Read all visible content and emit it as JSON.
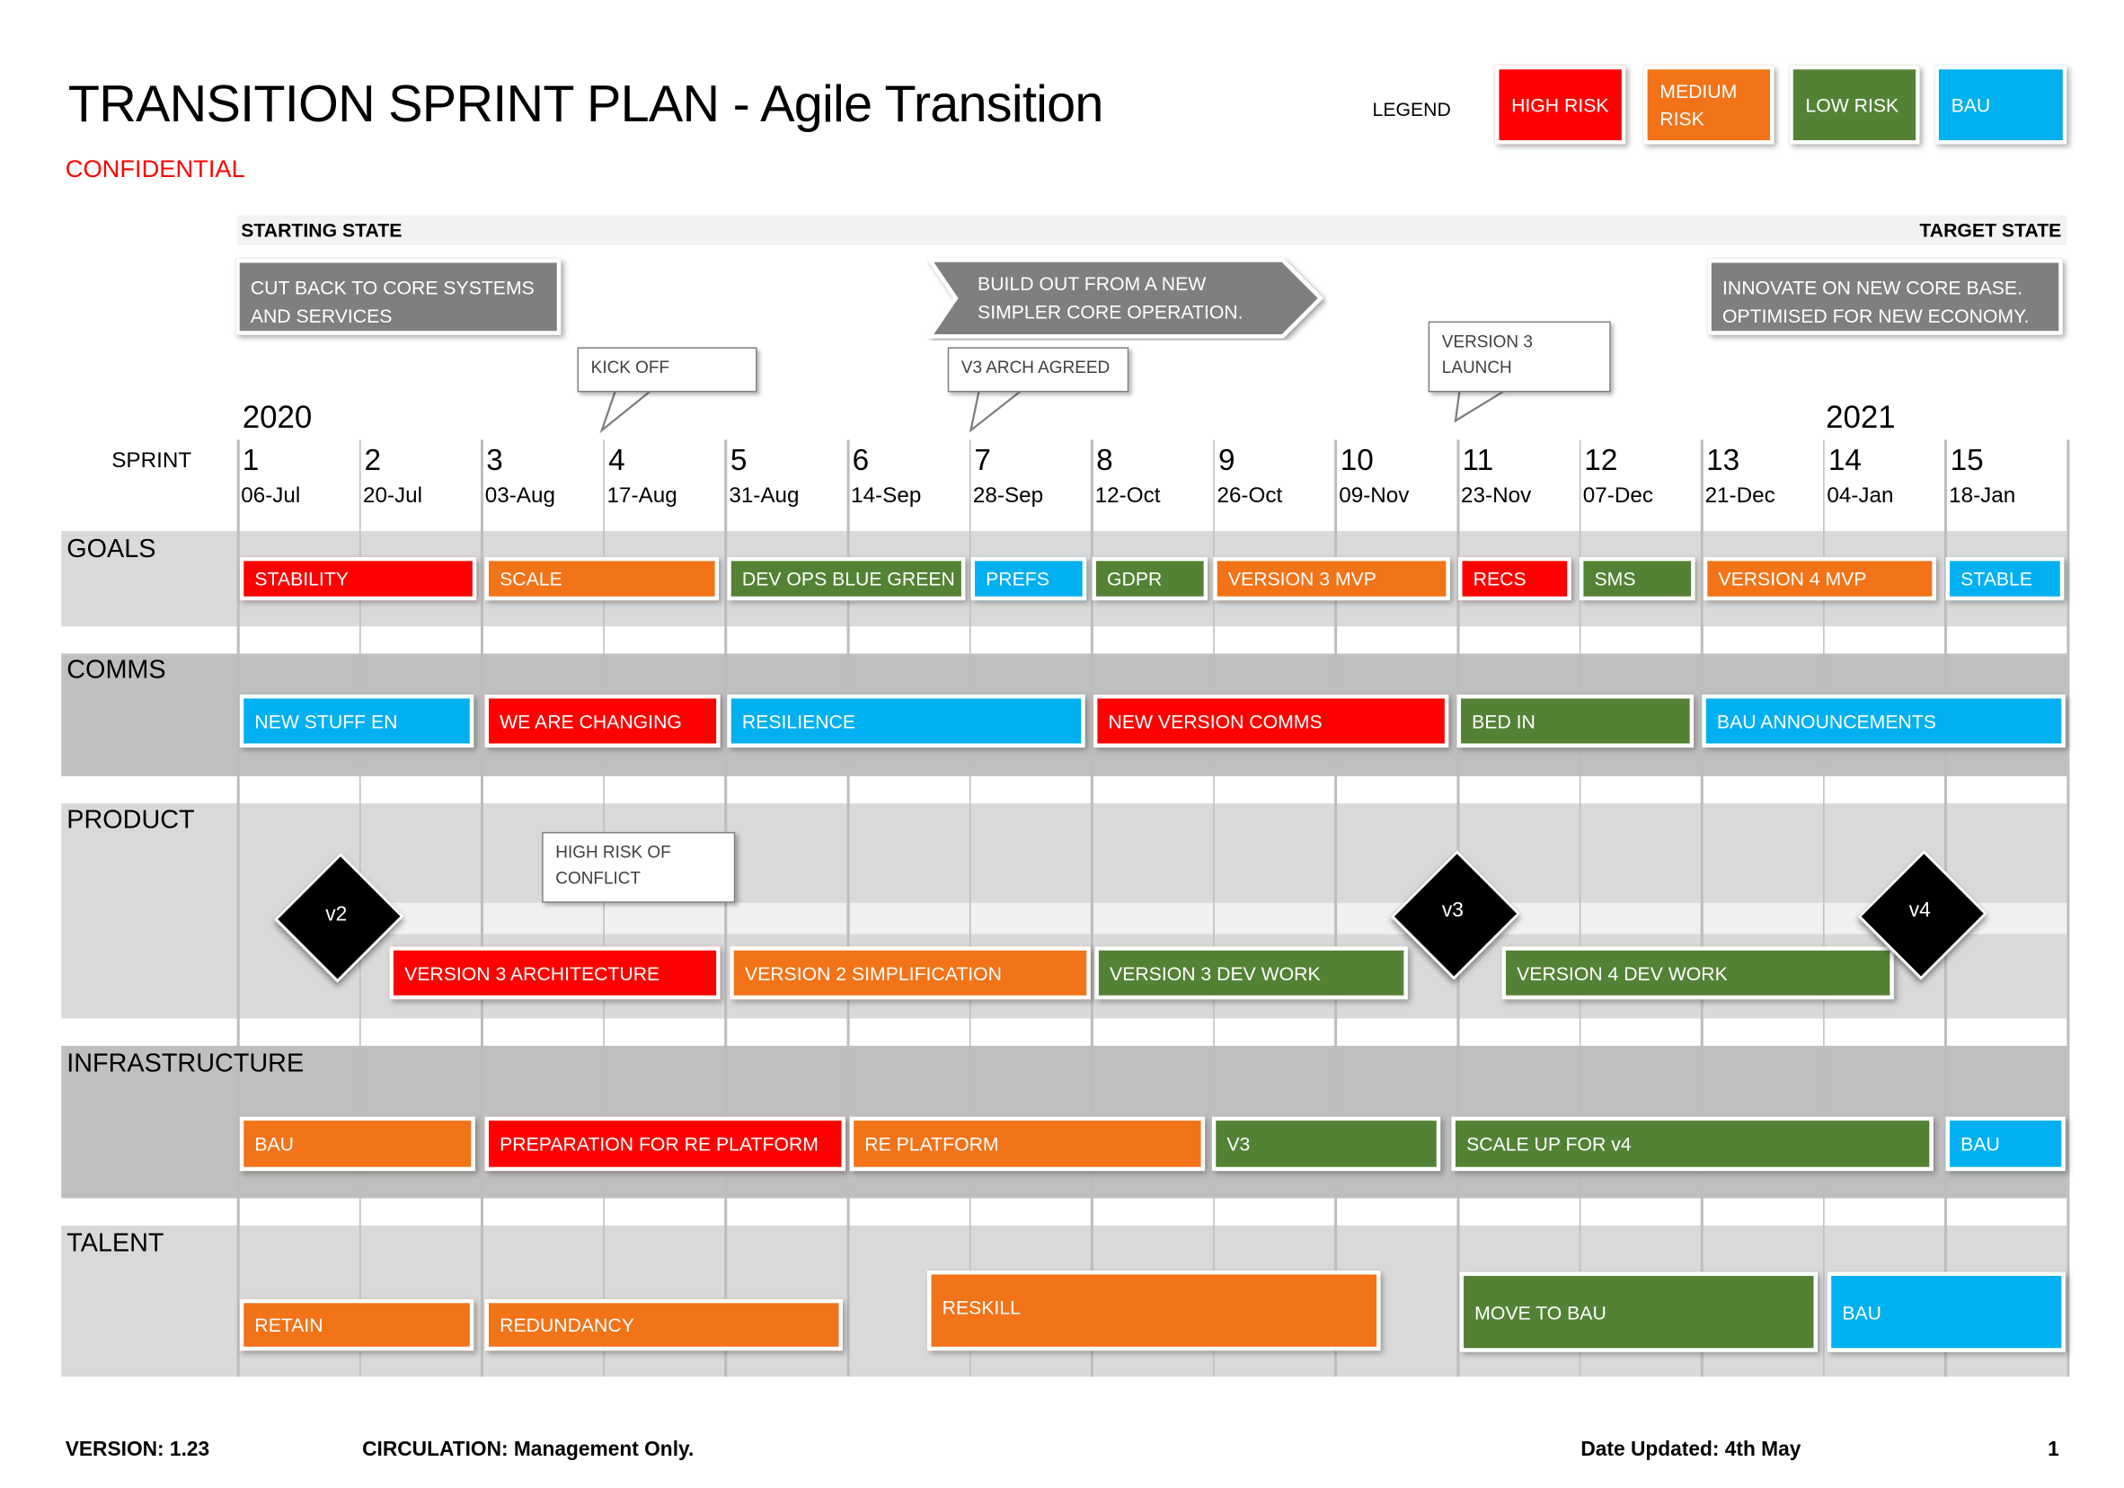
{
  "header": {
    "title": "TRANSITION SPRINT PLAN - Agile Transition",
    "confidential": "CONFIDENTIAL"
  },
  "colors": {
    "high": "#FF0000",
    "medium": "#F27318",
    "low": "#548235",
    "bau": "#00B0F0",
    "neutral": "#7F7F7F"
  },
  "legend": {
    "label": "LEGEND",
    "items": [
      {
        "label": "HIGH RISK",
        "risk": "high"
      },
      {
        "label": "MEDIUM RISK",
        "risk": "medium"
      },
      {
        "label": "LOW RISK",
        "risk": "low"
      },
      {
        "label": "BAU",
        "risk": "bau"
      }
    ]
  },
  "states": {
    "start": "STARTING STATE",
    "target": "TARGET STATE",
    "phases": [
      "CUT BACK TO CORE SYSTEMS AND SERVICES",
      "BUILD OUT FROM A NEW SIMPLER CORE OPERATION.",
      "INNOVATE ON NEW CORE BASE. OPTIMISED FOR NEW ECONOMY."
    ]
  },
  "callouts": [
    "KICK OFF",
    "V3 ARCH AGREED",
    "VERSION 3 LAUNCH",
    "HIGH RISK OF CONFLICT"
  ],
  "timeline": {
    "years": [
      "2020",
      "2021"
    ],
    "sprint_label": "SPRINT",
    "sprints": [
      {
        "n": "1",
        "date": "06-Jul"
      },
      {
        "n": "2",
        "date": "20-Jul"
      },
      {
        "n": "3",
        "date": "03-Aug"
      },
      {
        "n": "4",
        "date": "17-Aug"
      },
      {
        "n": "5",
        "date": "31-Aug"
      },
      {
        "n": "6",
        "date": "14-Sep"
      },
      {
        "n": "7",
        "date": "28-Sep"
      },
      {
        "n": "8",
        "date": "12-Oct"
      },
      {
        "n": "9",
        "date": "26-Oct"
      },
      {
        "n": "10",
        "date": "09-Nov"
      },
      {
        "n": "11",
        "date": "23-Nov"
      },
      {
        "n": "12",
        "date": "07-Dec"
      },
      {
        "n": "13",
        "date": "21-Dec"
      },
      {
        "n": "14",
        "date": "04-Jan"
      },
      {
        "n": "15",
        "date": "18-Jan"
      }
    ]
  },
  "rows": {
    "goals": {
      "label": "GOALS",
      "items": [
        {
          "label": "STABILITY",
          "risk": "high"
        },
        {
          "label": "SCALE",
          "risk": "medium"
        },
        {
          "label": "DEV OPS BLUE GREEN",
          "risk": "low"
        },
        {
          "label": "PREFS",
          "risk": "bau"
        },
        {
          "label": "GDPR",
          "risk": "low"
        },
        {
          "label": "VERSION 3 MVP",
          "risk": "medium"
        },
        {
          "label": "RECS",
          "risk": "high"
        },
        {
          "label": "SMS",
          "risk": "low"
        },
        {
          "label": "VERSION 4 MVP",
          "risk": "medium"
        },
        {
          "label": "STABLE",
          "risk": "bau"
        }
      ]
    },
    "comms": {
      "label": "COMMS",
      "items": [
        {
          "label": "NEW STUFF EN",
          "risk": "bau"
        },
        {
          "label": "WE ARE CHANGING",
          "risk": "high"
        },
        {
          "label": "RESILIENCE",
          "risk": "bau"
        },
        {
          "label": "NEW VERSION COMMS",
          "risk": "high"
        },
        {
          "label": "BED IN",
          "risk": "low"
        },
        {
          "label": "BAU ANNOUNCEMENTS",
          "risk": "bau"
        }
      ]
    },
    "product": {
      "label": "PRODUCT",
      "items": [
        {
          "label": "VERSION 3 ARCHITECTURE",
          "risk": "high"
        },
        {
          "label": "VERSION 2 SIMPLIFICATION",
          "risk": "medium"
        },
        {
          "label": "VERSION 3 DEV WORK",
          "risk": "low"
        },
        {
          "label": "VERSION 4 DEV WORK",
          "risk": "low"
        }
      ],
      "milestones": [
        "v2",
        "v3",
        "v4"
      ]
    },
    "infrastructure": {
      "label": "INFRASTRUCTURE",
      "items": [
        {
          "label": "BAU",
          "risk": "medium"
        },
        {
          "label": "PREPARATION FOR RE PLATFORM",
          "risk": "high"
        },
        {
          "label": "RE PLATFORM",
          "risk": "medium"
        },
        {
          "label": "V3",
          "risk": "low"
        },
        {
          "label": "SCALE UP FOR v4",
          "risk": "low"
        },
        {
          "label": "BAU",
          "risk": "bau"
        }
      ]
    },
    "talent": {
      "label": "TALENT",
      "items": [
        {
          "label": "RETAIN",
          "risk": "medium"
        },
        {
          "label": "REDUNDANCY",
          "risk": "medium"
        },
        {
          "label": "RESKILL",
          "risk": "medium"
        },
        {
          "label": "MOVE TO BAU",
          "risk": "low"
        },
        {
          "label": "BAU",
          "risk": "bau"
        }
      ]
    }
  },
  "footer": {
    "version": "VERSION: 1.23",
    "circulation": "CIRCULATION: Management Only.",
    "date": "Date Updated: 4th May",
    "page": "1"
  }
}
